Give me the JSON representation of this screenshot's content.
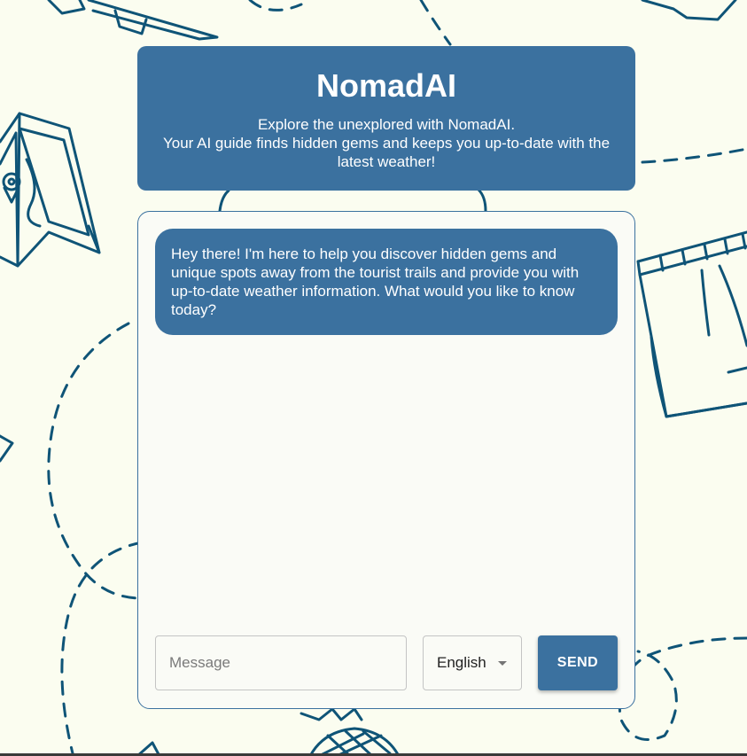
{
  "header": {
    "title": "NomadAI",
    "subtitle_line1": "Explore the unexplored with NomadAI.",
    "subtitle_line2": "Your AI guide finds hidden gems and keeps you up-to-date with the latest weather!"
  },
  "chat": {
    "messages": [
      {
        "role": "assistant",
        "text": "Hey there! I'm here to help you discover hidden gems and unique spots away from the tourist trails and provide you with up-to-date weather information. What would you like to know today?"
      }
    ]
  },
  "composer": {
    "message_placeholder": "Message",
    "message_value": "",
    "language_selected": "English",
    "send_label": "SEND"
  },
  "colors": {
    "accent": "#3b719f",
    "background": "#fbfdf0",
    "doodle": "#0f5477"
  }
}
